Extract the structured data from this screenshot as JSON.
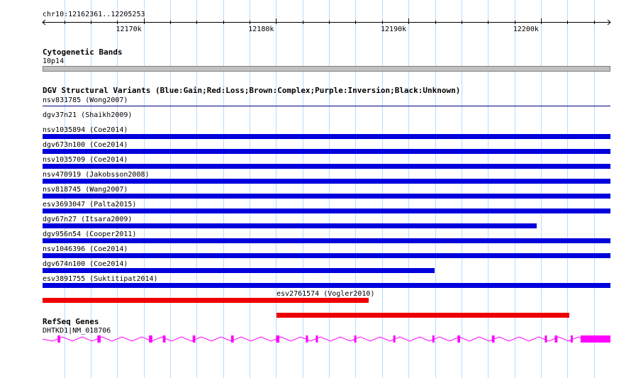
{
  "ruler": {
    "location": "chr10:12162361..12205253",
    "start": 12162361,
    "end": 12205253,
    "ticks": [
      12170000,
      12180000,
      12190000,
      12200000
    ],
    "tick_labels": [
      "12170k",
      "12180k",
      "12190k",
      "12200k"
    ]
  },
  "cytoband": {
    "title": "Cytogenetic Bands",
    "band_label": "10p14"
  },
  "dgv": {
    "title": "DGV Structural Variants (Blue:Gain;Red:Loss;Brown:Complex;Purple:Inversion;Black:Unknown)",
    "variants": [
      {
        "label": "nsv831785 (Wong2007)",
        "type": "gain",
        "start": 12162361,
        "end": 12205253,
        "style": "line"
      },
      {
        "label": "dgv37n21 (Shaikh2009)",
        "type": "gain",
        "start": 12162361,
        "end": 12205253
      },
      {
        "label": "nsv1035894 (Coe2014)",
        "type": "gain",
        "start": 12162361,
        "end": 12205253
      },
      {
        "label": "dgv673n100 (Coe2014)",
        "type": "gain",
        "start": 12162361,
        "end": 12205253
      },
      {
        "label": "nsv1035709 (Coe2014)",
        "type": "gain",
        "start": 12162361,
        "end": 12205253
      },
      {
        "label": "nsv470919 (Jakobsson2008)",
        "type": "gain",
        "start": 12162361,
        "end": 12205253
      },
      {
        "label": "nsv818745 (Wang2007)",
        "type": "gain",
        "start": 12162361,
        "end": 12205253
      },
      {
        "label": "esv3693047 (Palta2015)",
        "type": "gain",
        "start": 12162361,
        "end": 12199700
      },
      {
        "label": "dgv67n27 (Itsara2009)",
        "type": "gain",
        "start": 12162361,
        "end": 12205253
      },
      {
        "label": "dgv956n54 (Cooper2011)",
        "type": "gain",
        "start": 12162361,
        "end": 12205253
      },
      {
        "label": "nsv1046396 (Coe2014)",
        "type": "gain",
        "start": 12162361,
        "end": 12191950
      },
      {
        "label": "dgv674n100 (Coe2014)",
        "type": "gain",
        "start": 12162361,
        "end": 12205253
      },
      {
        "label": "esv3891755 (Suktitipat2014)",
        "type": "loss",
        "start": 12162361,
        "end": 12187000
      },
      {
        "label": "esv2761574 (Vogler2010)",
        "type": "loss",
        "start": 12180050,
        "end": 12202150
      }
    ],
    "colors": {
      "gain": "#0000dd",
      "loss": "#ee0000"
    }
  },
  "refseq": {
    "title": "RefSeq Genes",
    "gene_label": "DHTKD1|NM_018706",
    "color": "#ff00ff",
    "strand": "+",
    "exons": [
      [
        12163500,
        12163700
      ],
      [
        12166500,
        12166750
      ],
      [
        12170400,
        12170650
      ],
      [
        12171450,
        12171650
      ],
      [
        12173700,
        12173900
      ],
      [
        12176600,
        12176800
      ],
      [
        12180000,
        12180250
      ],
      [
        12182250,
        12182350
      ],
      [
        12183000,
        12183120
      ],
      [
        12185900,
        12186050
      ],
      [
        12188850,
        12189000
      ],
      [
        12191800,
        12191950
      ],
      [
        12193700,
        12193900
      ],
      [
        12196300,
        12196500
      ],
      [
        12200300,
        12200450
      ],
      [
        12201050,
        12201250
      ],
      [
        12202250,
        12202350
      ],
      [
        12203000,
        12205253
      ]
    ]
  }
}
